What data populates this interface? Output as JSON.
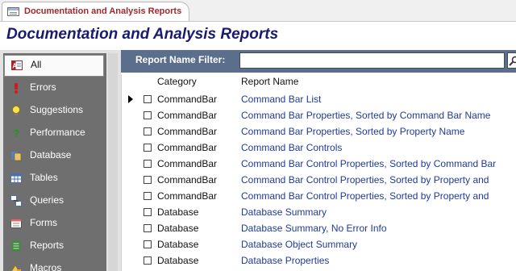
{
  "tab": {
    "label": "Documentation and Analysis Reports"
  },
  "header": {
    "title": "Documentation and Analysis Reports"
  },
  "sidebar": {
    "items": [
      {
        "label": "All",
        "icon": "access-report-icon",
        "selected": true
      },
      {
        "label": "Errors",
        "icon": "exclamation-icon"
      },
      {
        "label": "Suggestions",
        "icon": "lightbulb-icon"
      },
      {
        "label": "Performance",
        "icon": "question-mark-icon"
      },
      {
        "label": "Database",
        "icon": "database-icon"
      },
      {
        "label": "Tables",
        "icon": "table-icon"
      },
      {
        "label": "Queries",
        "icon": "query-icon"
      },
      {
        "label": "Forms",
        "icon": "form-icon"
      },
      {
        "label": "Reports",
        "icon": "report-icon"
      },
      {
        "label": "Macros",
        "icon": "macro-icon"
      }
    ]
  },
  "filter": {
    "label": "Report Name Filter:",
    "value": ""
  },
  "table": {
    "columns": {
      "category": "Category",
      "report_name": "Report Name"
    },
    "rows": [
      {
        "category": "CommandBar",
        "name": "Command Bar List",
        "current": true
      },
      {
        "category": "CommandBar",
        "name": "Command Bar Properties, Sorted by Command Bar Name"
      },
      {
        "category": "CommandBar",
        "name": "Command Bar Properties, Sorted by Property Name"
      },
      {
        "category": "CommandBar",
        "name": "Command Bar Controls"
      },
      {
        "category": "CommandBar",
        "name": "Command Bar Control Properties, Sorted by Command Bar"
      },
      {
        "category": "CommandBar",
        "name": "Command Bar Control Properties, Sorted by Property and"
      },
      {
        "category": "CommandBar",
        "name": "Command Bar Control Properties, Sorted by Property and"
      },
      {
        "category": "Database",
        "name": "Database Summary"
      },
      {
        "category": "Database",
        "name": "Database Summary, No Error Info"
      },
      {
        "category": "Database",
        "name": "Database Object Summary"
      },
      {
        "category": "Database",
        "name": "Database Properties"
      }
    ]
  },
  "colors": {
    "title": "#1a1a6e",
    "tab_text": "#a4262c",
    "filter_bar": "#5b6f8d",
    "link": "#1f3a99",
    "nav_bg": "#6f6f6f"
  }
}
